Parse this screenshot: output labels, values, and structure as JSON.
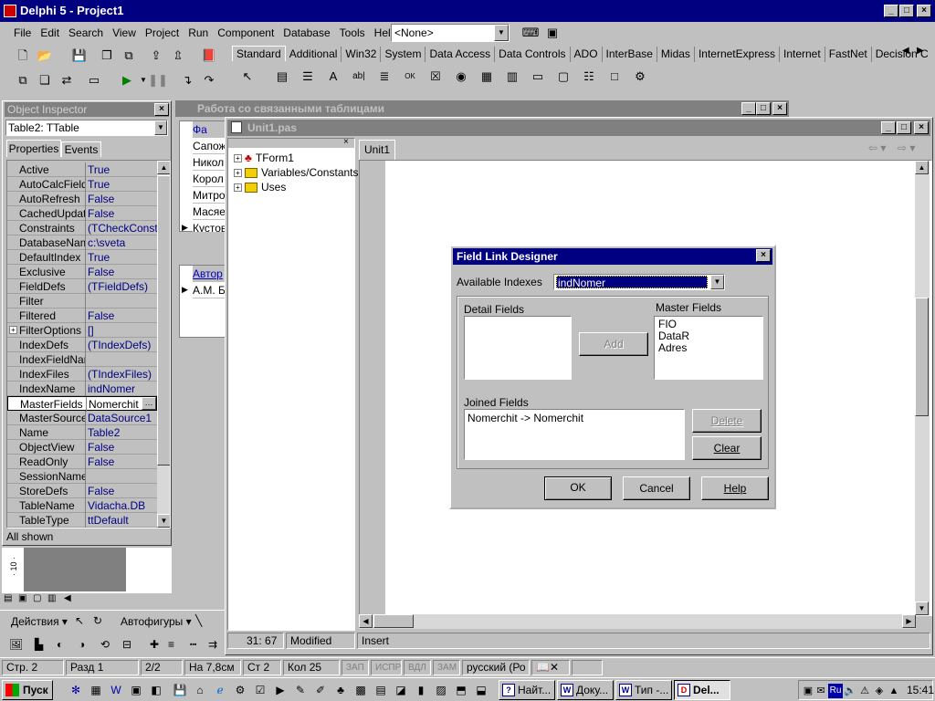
{
  "main_window": {
    "title": "Delphi 5 - Project1",
    "menu": [
      "File",
      "Edit",
      "Search",
      "View",
      "Project",
      "Run",
      "Component",
      "Database",
      "Tools",
      "Help"
    ],
    "desktop_combo": "<None>",
    "palette_tabs": [
      "Standard",
      "Additional",
      "Win32",
      "System",
      "Data Access",
      "Data Controls",
      "ADO",
      "InterBase",
      "Midas",
      "InternetExpress",
      "Internet",
      "FastNet",
      "Decision C"
    ]
  },
  "background_title": "Работа со связанными таблицами",
  "object_inspector": {
    "title": "Object Inspector",
    "selected": "Table2: TTable",
    "tabs": [
      "Properties",
      "Events"
    ],
    "rows": [
      {
        "k": "Active",
        "v": "True"
      },
      {
        "k": "AutoCalcFields",
        "v": "True"
      },
      {
        "k": "AutoRefresh",
        "v": "False"
      },
      {
        "k": "CachedUpdates",
        "v": "False"
      },
      {
        "k": "Constraints",
        "v": "(TCheckConstra"
      },
      {
        "k": "DatabaseName",
        "v": "c:\\sveta"
      },
      {
        "k": "DefaultIndex",
        "v": "True"
      },
      {
        "k": "Exclusive",
        "v": "False"
      },
      {
        "k": "FieldDefs",
        "v": "(TFieldDefs)"
      },
      {
        "k": "Filter",
        "v": ""
      },
      {
        "k": "Filtered",
        "v": "False"
      },
      {
        "k": "FilterOptions",
        "v": "[]"
      },
      {
        "k": "IndexDefs",
        "v": "(TIndexDefs)"
      },
      {
        "k": "IndexFieldName",
        "v": ""
      },
      {
        "k": "IndexFiles",
        "v": "(TIndexFiles)"
      },
      {
        "k": "IndexName",
        "v": "indNomer"
      },
      {
        "k": "MasterFields",
        "v": "Nomerchit"
      },
      {
        "k": "MasterSource",
        "v": "DataSource1"
      },
      {
        "k": "Name",
        "v": "Table2"
      },
      {
        "k": "ObjectView",
        "v": "False"
      },
      {
        "k": "ReadOnly",
        "v": "False"
      },
      {
        "k": "SessionName",
        "v": ""
      },
      {
        "k": "StoreDefs",
        "v": "False"
      },
      {
        "k": "TableName",
        "v": "Vidacha.DB"
      },
      {
        "k": "TableType",
        "v": "ttDefault"
      }
    ],
    "status": "All shown"
  },
  "form_grid": {
    "header": "Фа",
    "rows": [
      "Сапож",
      "Никол",
      "Корол",
      "Митро",
      "Масяе",
      "Кустов"
    ],
    "grid2_header": "Автор",
    "grid2_rows": [
      "А.М. Б"
    ]
  },
  "editor": {
    "title": "Unit1.pas",
    "tree": [
      "TForm1",
      "Variables/Constants",
      "Uses"
    ],
    "tab": "Unit1",
    "position": "31: 67",
    "modified": "Modified",
    "mode": "Insert"
  },
  "dialog": {
    "title": "Field Link Designer",
    "available_indexes_label": "Available Indexes",
    "available_indexes_value": "indNomer",
    "detail_fields_label": "Detail Fields",
    "master_fields_label": "Master Fields",
    "master_fields": [
      "FIO",
      "DataR",
      "Adres"
    ],
    "add_label": "Add",
    "joined_fields_label": "Joined Fields",
    "joined_fields": [
      "Nomerchit -> Nomerchit"
    ],
    "delete_label": "Delete",
    "clear_label": "Clear",
    "ok_label": "OK",
    "cancel_label": "Cancel",
    "help_label": "Help"
  },
  "word_bar": {
    "actions": "Действия",
    "autoshapes": "Автофигуры"
  },
  "word_status": {
    "page": "Стр. 2",
    "section": "Разд 1",
    "pages": "2/2",
    "at": "На 7,8см",
    "line": "Ст 2",
    "col": "Кол 25",
    "rec": "ЗАП",
    "trk": "ИСПР",
    "ext": "ВДЛ",
    "ovr": "ЗАМ",
    "lang": "русский (Ро"
  },
  "taskbar": {
    "start": "Пуск",
    "tasks": [
      "Найт...",
      "Доку...",
      "Тип -...",
      "Del..."
    ],
    "lang": "Ru",
    "clock": "15:41"
  }
}
